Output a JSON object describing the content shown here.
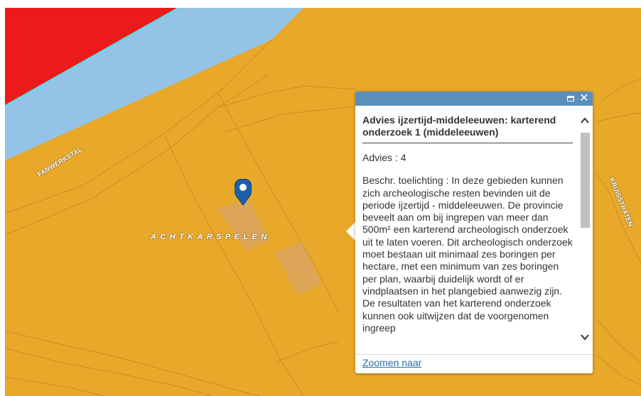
{
  "map": {
    "colors": {
      "base": "#E8A82A",
      "water": "#93C4E8",
      "red_zone": "#EC1A1A",
      "water_edge": "#4FE0E8",
      "parcel_lines": "#C98F24",
      "parcel_fill": "#D9A55F"
    },
    "labels": {
      "road_left": "FANWERKSTAL",
      "place": "ACHTKARSPELEN",
      "road_right": "KRUISSTRATEN"
    },
    "marker_icon": "map-pin-icon"
  },
  "popup": {
    "header_color": "#5A8FBB",
    "maximize_icon": "maximize-icon",
    "close_icon": "close-icon",
    "title": "Advies ijzertijd-middeleeuwen: karterend onderzoek 1 (middeleeuwen)",
    "advies": "Advies : 4",
    "beschrijving": "Beschr. toelichting : In deze gebieden kunnen zich archeologische resten bevinden uit de periode ijzertijd - middeleeuwen. De provincie beveelt aan om bij ingrepen van meer dan 500m² een karterend archeologisch onderzoek uit te laten voeren. Dit archeologisch onderzoek moet bestaan uit minimaal zes boringen per hectare, met een minimum van zes boringen per plan, waarbij duidelijk wordt of er vindplaatsen in het plangebied aanwezig zijn. De resultaten van het karterend onderzoek kunnen ook uitwijzen dat de voorgenomen ingreep",
    "scroll_up_icon": "chevron-up-icon",
    "scroll_down_icon": "chevron-down-icon",
    "zoom_link": "Zoomen naar"
  }
}
